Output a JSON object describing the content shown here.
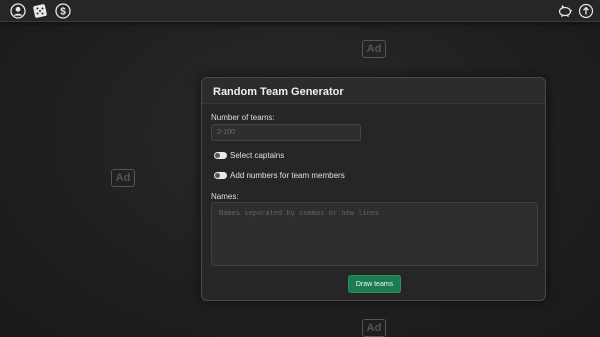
{
  "header": {
    "icons": [
      "user-icon",
      "dice-icon",
      "dollar-icon",
      "piggy-bank-icon",
      "arrow-up-icon"
    ]
  },
  "ads": [
    "Ad",
    "Ad",
    "Ad"
  ],
  "form": {
    "title": "Random Team Generator",
    "teams_label": "Number of teams:",
    "teams_value": "",
    "teams_placeholder": "2-100",
    "captains_label": "Select captains",
    "numbers_label": "Add numbers for team members",
    "names_label": "Names:",
    "names_value": "",
    "names_placeholder": "Names separated by commas or new lines",
    "submit_label": "Draw teams"
  },
  "colors": {
    "background": "#222222",
    "card": "#262626",
    "accent": "#1e7a50"
  }
}
